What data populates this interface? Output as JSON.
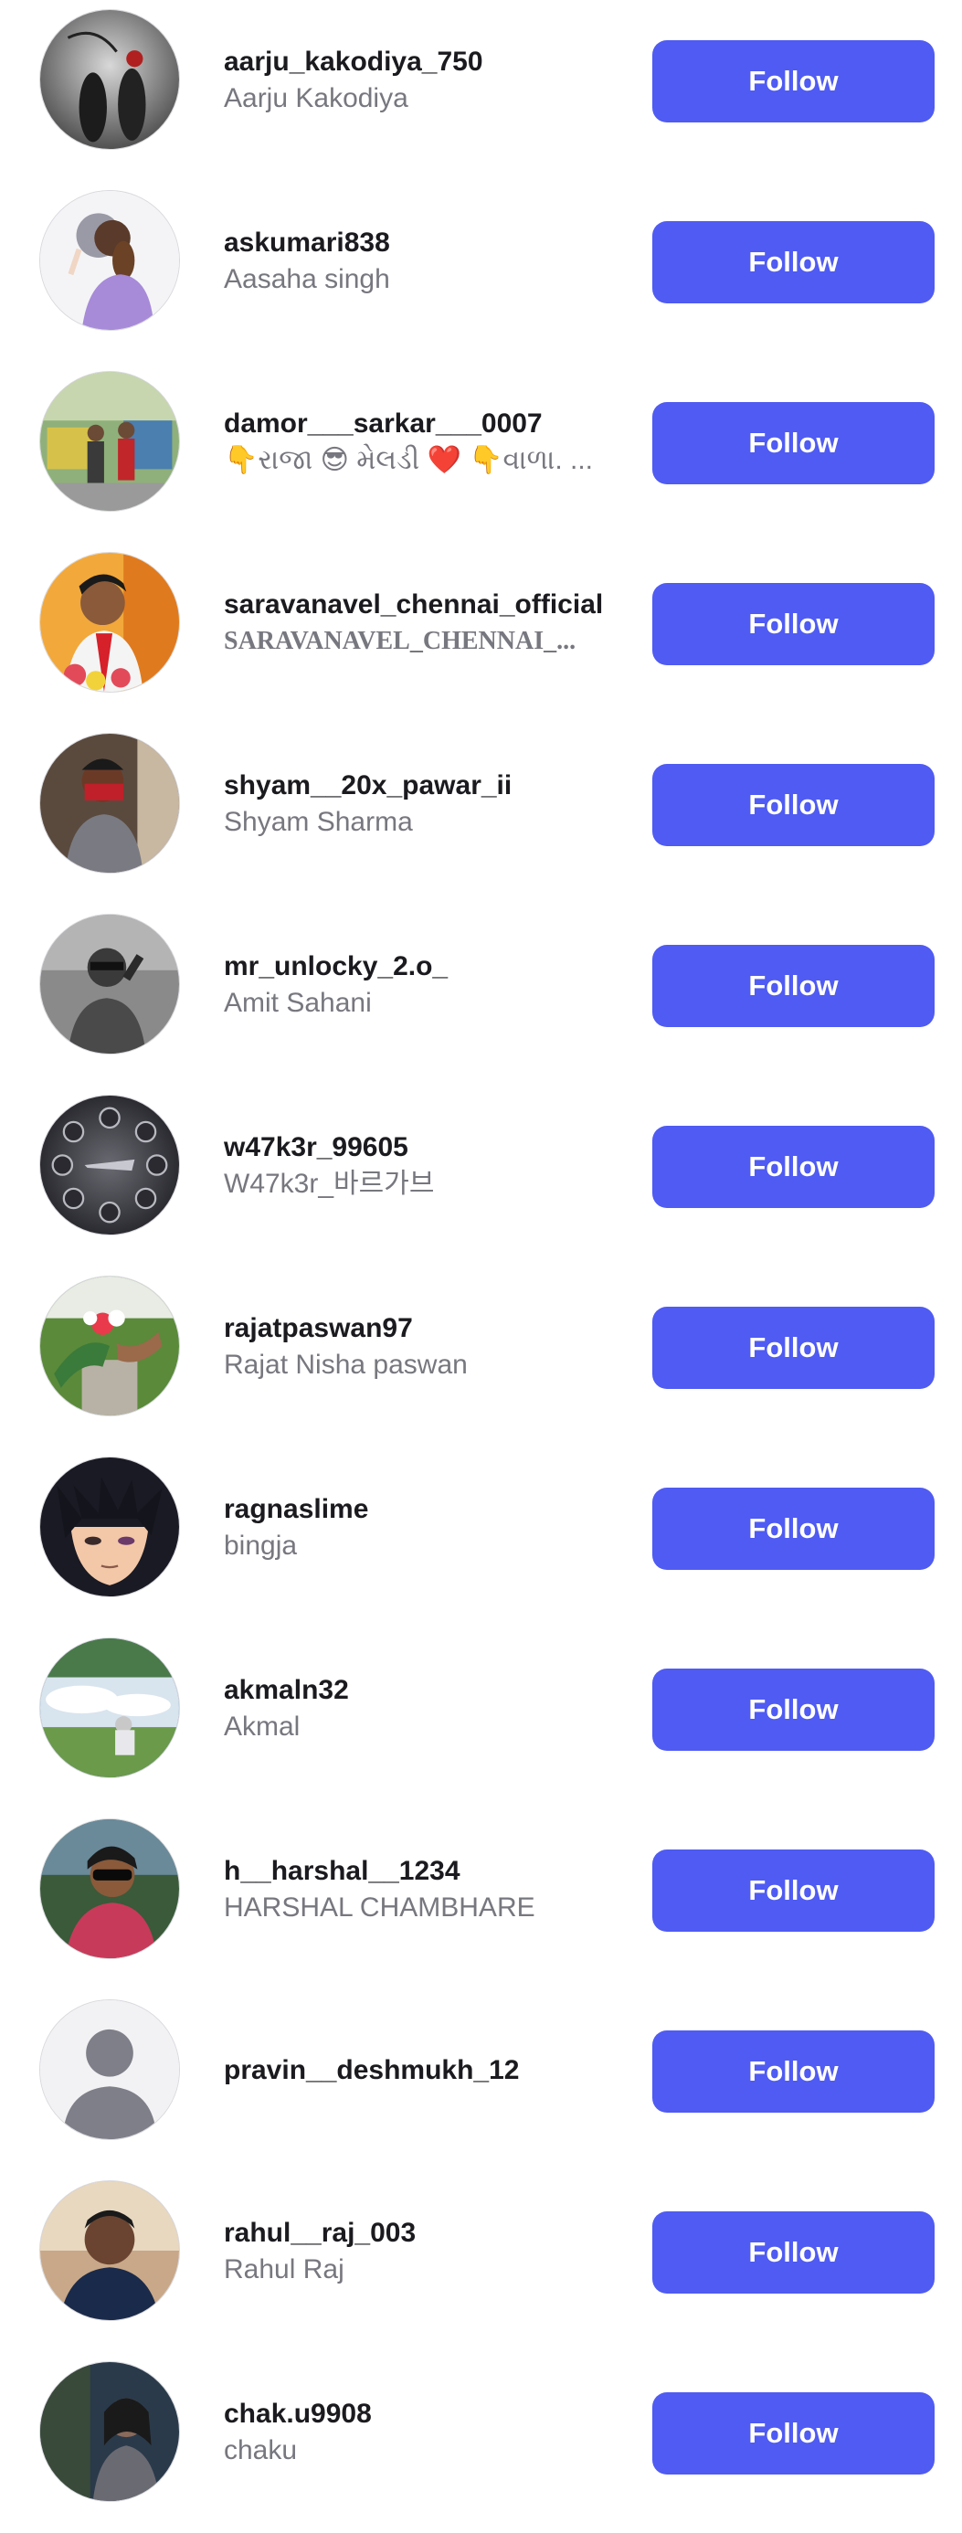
{
  "colors": {
    "follow_button_bg": "#4f5bf2",
    "follow_button_text": "#ffffff",
    "username_text": "#1b1b1f",
    "fullname_text": "#77777f"
  },
  "users": [
    {
      "username": "aarju_kakodiya_750",
      "fullname": "Aarju Kakodiya",
      "follow_label": "Follow",
      "avatar": "photo-avatar-icon"
    },
    {
      "username": "askumari838",
      "fullname": "Aasaha singh",
      "follow_label": "Follow",
      "avatar": "photo-avatar-icon"
    },
    {
      "username": "damor___sarkar___0007",
      "fullname": "👇રાજા 😎 મેલડી ❤️ 👇વાળા. ...",
      "follow_label": "Follow",
      "avatar": "photo-avatar-icon"
    },
    {
      "username": "saravanavel_chennai_official",
      "fullname": "SARAVANAVEL_CHENNAI_...",
      "follow_label": "Follow",
      "avatar": "photo-avatar-icon"
    },
    {
      "username": "shyam__20x_pawar_ii",
      "fullname": "Shyam Sharma",
      "follow_label": "Follow",
      "avatar": "photo-avatar-icon"
    },
    {
      "username": "mr_unlocky_2.o_",
      "fullname": "Amit Sahani",
      "follow_label": "Follow",
      "avatar": "photo-avatar-icon"
    },
    {
      "username": "w47k3r_99605",
      "fullname": "W47k3r_바르가브",
      "follow_label": "Follow",
      "avatar": "photo-avatar-icon"
    },
    {
      "username": "rajatpaswan97",
      "fullname": "Rajat Nisha  paswan",
      "follow_label": "Follow",
      "avatar": "photo-avatar-icon"
    },
    {
      "username": "ragnaslime",
      "fullname": "bingja",
      "follow_label": "Follow",
      "avatar": "photo-avatar-icon"
    },
    {
      "username": "akmaln32",
      "fullname": "Akmal",
      "follow_label": "Follow",
      "avatar": "photo-avatar-icon"
    },
    {
      "username": "h__harshal__1234",
      "fullname": "HARSHAL CHAMBHARE",
      "follow_label": "Follow",
      "avatar": "photo-avatar-icon"
    },
    {
      "username": "pravin__deshmukh_12",
      "fullname": "",
      "follow_label": "Follow",
      "avatar": "default-avatar-icon"
    },
    {
      "username": "rahul__raj_003",
      "fullname": "Rahul Raj",
      "follow_label": "Follow",
      "avatar": "photo-avatar-icon"
    },
    {
      "username": "chak.u9908",
      "fullname": "chaku",
      "follow_label": "Follow",
      "avatar": "photo-avatar-icon"
    }
  ]
}
